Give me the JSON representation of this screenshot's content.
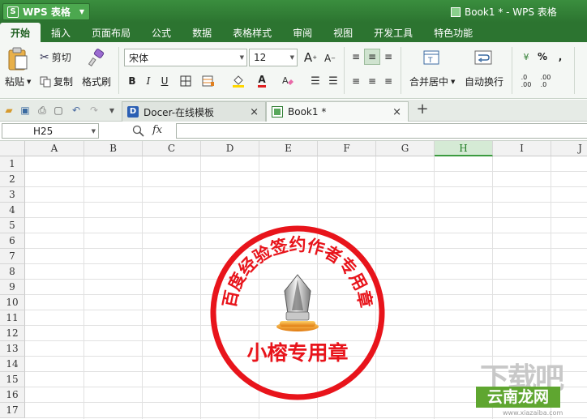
{
  "app": {
    "name": "WPS 表格",
    "logo_glyph": "S",
    "doc_title": "Book1 * - WPS 表格"
  },
  "menu": {
    "tabs": [
      "开始",
      "插入",
      "页面布局",
      "公式",
      "数据",
      "表格样式",
      "审阅",
      "视图",
      "开发工具",
      "特色功能"
    ],
    "active": "开始"
  },
  "ribbon": {
    "paste_label": "粘贴",
    "cut_label": "剪切",
    "copy_label": "复制",
    "format_painter_label": "格式刷",
    "font_name": "宋体",
    "font_size": "12",
    "grow_font": "A",
    "shrink_font": "A",
    "bold": "B",
    "italic": "I",
    "underline": "U",
    "font_color_glyph": "A",
    "merge_center_label": "合并居中",
    "wrap_text_label": "自动换行",
    "percent_glyph": "%",
    "comma_glyph": ",",
    "accent_colors": {
      "fill": "#ffd700",
      "font": "#e02020"
    }
  },
  "tabstrip": {
    "tabs": [
      {
        "label": "Docer-在线模板",
        "close": "×"
      },
      {
        "label": "Book1 *",
        "close": "×"
      }
    ],
    "new_tab": "+"
  },
  "formula_bar": {
    "name_box": "H25",
    "fx": "fx",
    "formula": ""
  },
  "sheet": {
    "columns": [
      "A",
      "B",
      "C",
      "D",
      "E",
      "F",
      "G",
      "H",
      "I",
      "J"
    ],
    "selected_column": "H",
    "rows": [
      "1",
      "2",
      "3",
      "4",
      "5",
      "6",
      "7",
      "8",
      "9",
      "10",
      "11",
      "12",
      "13",
      "14",
      "15",
      "16",
      "17"
    ]
  },
  "seal": {
    "arc_text": "百度经验签约作者专用章",
    "center_text": "小榕专用章",
    "color": "#e8141b",
    "icon": "fountain-pen-nib-icon"
  },
  "watermark": {
    "logo": "下载吧",
    "site_name": "云南龙网",
    "url": "www.xiazaiba.com"
  }
}
